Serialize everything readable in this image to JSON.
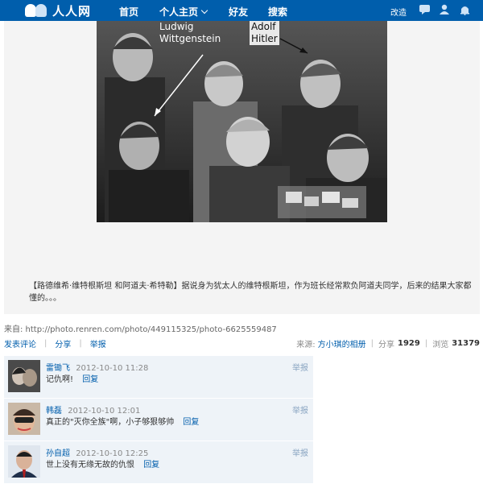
{
  "nav": {
    "logo_text": "人人网",
    "items": [
      {
        "label": "首页"
      },
      {
        "label": "个人主页"
      },
      {
        "label": "好友"
      },
      {
        "label": "搜索"
      }
    ],
    "right_link": "改造",
    "icons": [
      "message-icon",
      "friend-request-icon",
      "notification-bell-icon"
    ]
  },
  "photo": {
    "label_wittgenstein_1": "Ludwig",
    "label_wittgenstein_2": "Wittgenstein",
    "label_hitler_1": "Adolf",
    "label_hitler_2": "Hitler",
    "caption": "【路德维希·维特根斯坦 和阿道夫·希特勒】据说身为犹太人的维特根斯坦，作为班长经常欺负阿道夫同学，后来的结果大家都懂的。。。"
  },
  "source_line": "来自: http://photo.renren.com/photo/449115325/photo-6625559487",
  "actions": {
    "comment": "发表评论",
    "share": "分享",
    "report": "举报"
  },
  "meta": {
    "source_label": "来源:",
    "source_album": "方小琪的相册",
    "share_label": "分享",
    "share_count": "1929",
    "views_label": "浏览",
    "views_count": "31379"
  },
  "comments": [
    {
      "name": "雷锄飞",
      "time": "2012-10-10 11:28",
      "text": "记仇啊!",
      "reply": "回复",
      "report": "举报"
    },
    {
      "name": "韩磊",
      "time": "2012-10-10 12:01",
      "text": "真正的\"灭你全族\"啊，小子够狠够帅",
      "reply": "回复",
      "report": "举报"
    },
    {
      "name": "孙自超",
      "time": "2012-10-10 12:25",
      "text": "世上没有无缘无故的仇恨",
      "reply": "回复",
      "report": "举报"
    }
  ],
  "colors": {
    "nav_bg": "#005eac",
    "link": "#005eac",
    "comment_bg": "#eef3f8"
  }
}
